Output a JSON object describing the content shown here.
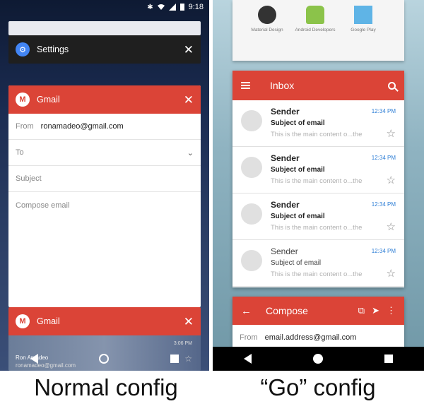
{
  "left": {
    "status_time": "9:18",
    "settings_card": {
      "title": "Settings"
    },
    "gmail_compose_card": {
      "title": "Gmail",
      "from_label": "From",
      "from_value": "ronamadeo@gmail.com",
      "to_label": "To",
      "subject_placeholder": "Subject",
      "body_placeholder": "Compose email"
    },
    "gmail_bottom_card": {
      "title": "Gmail",
      "time": "3:06 PM",
      "account_name": "Ron Amadeo",
      "account_email": "ronamadeo@gmail.com"
    }
  },
  "right": {
    "launcher_apps": [
      {
        "label": "Material Design",
        "icon": "material-design-icon"
      },
      {
        "label": "Android Developers",
        "icon": "android-icon"
      },
      {
        "label": "Google Play",
        "icon": "google-play-icon"
      }
    ],
    "inbox": {
      "title": "Inbox",
      "emails": [
        {
          "sender": "Sender",
          "subject": "Subject of email",
          "preview": "This is the main content o...the",
          "time": "12:34 PM"
        },
        {
          "sender": "Sender",
          "subject": "Subject of email",
          "preview": "This is the main content o...the",
          "time": "12:34 PM"
        },
        {
          "sender": "Sender",
          "subject": "Subject of email",
          "preview": "This is the main content o...the",
          "time": "12:34 PM"
        },
        {
          "sender": "Sender",
          "subject": "Subject of email",
          "preview": "This is the main content o...the",
          "time": "12:34 PM"
        }
      ]
    },
    "compose": {
      "title": "Compose",
      "from_label": "From",
      "from_value": "email.address@gmail.com"
    }
  },
  "captions": {
    "left": "Normal config",
    "right": "“Go” config"
  },
  "colors": {
    "gmail_red": "#db4437",
    "settings_blue": "#4285f4",
    "time_blue": "#2f7fd6"
  }
}
